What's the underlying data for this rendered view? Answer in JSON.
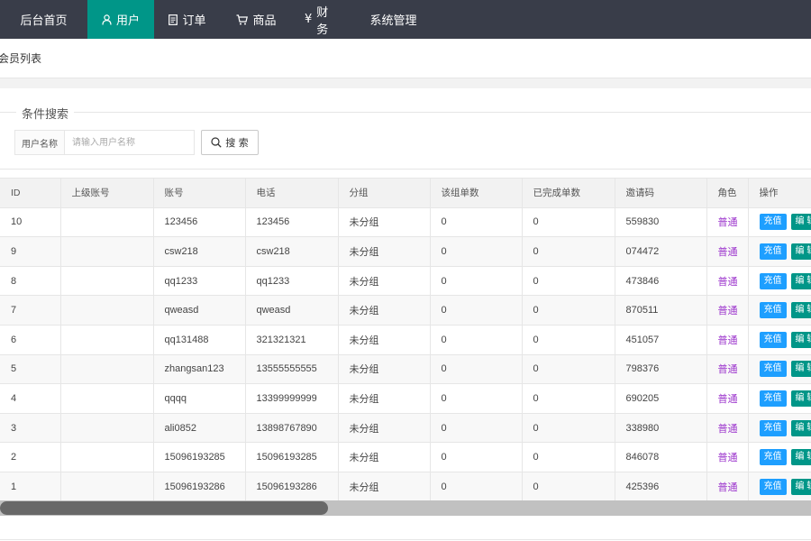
{
  "nav": {
    "items": [
      {
        "label": "后台首页",
        "icon": ""
      },
      {
        "label": "用户",
        "icon": "user-icon"
      },
      {
        "label": "订单",
        "icon": "document-icon"
      },
      {
        "label": "商品",
        "icon": "cart-icon"
      },
      {
        "label": "财务",
        "icon": "yen-icon",
        "prefix": "¥"
      },
      {
        "label": "系统管理",
        "icon": ""
      }
    ],
    "active_index": 1,
    "colors": {
      "bar": "#393d49",
      "active": "#009688"
    }
  },
  "breadcrumb": {
    "title": "会员列表"
  },
  "search": {
    "legend": "条件搜索",
    "field_label": "用户名称",
    "placeholder": "请输入用户名称",
    "value": "",
    "button_label": "搜 索"
  },
  "table": {
    "columns": [
      "ID",
      "上级账号",
      "账号",
      "电话",
      "分组",
      "该组单数",
      "已完成单数",
      "邀请码",
      "角色",
      "操作"
    ],
    "rows": [
      {
        "id": "10",
        "parent": "",
        "account": "123456",
        "phone": "123456",
        "group": "未分组",
        "group_orders": "0",
        "completed": "0",
        "invite": "559830",
        "role": "普通"
      },
      {
        "id": "9",
        "parent": "",
        "account": "csw218",
        "phone": "csw218",
        "group": "未分组",
        "group_orders": "0",
        "completed": "0",
        "invite": "074472",
        "role": "普通"
      },
      {
        "id": "8",
        "parent": "",
        "account": "qq1233",
        "phone": "qq1233",
        "group": "未分组",
        "group_orders": "0",
        "completed": "0",
        "invite": "473846",
        "role": "普通"
      },
      {
        "id": "7",
        "parent": "",
        "account": "qweasd",
        "phone": "qweasd",
        "group": "未分组",
        "group_orders": "0",
        "completed": "0",
        "invite": "870511",
        "role": "普通"
      },
      {
        "id": "6",
        "parent": "",
        "account": "qq131488",
        "phone": "321321321",
        "group": "未分组",
        "group_orders": "0",
        "completed": "0",
        "invite": "451057",
        "role": "普通"
      },
      {
        "id": "5",
        "parent": "",
        "account": "zhangsan123",
        "phone": "13555555555",
        "group": "未分组",
        "group_orders": "0",
        "completed": "0",
        "invite": "798376",
        "role": "普通"
      },
      {
        "id": "4",
        "parent": "",
        "account": "qqqq",
        "phone": "13399999999",
        "group": "未分组",
        "group_orders": "0",
        "completed": "0",
        "invite": "690205",
        "role": "普通"
      },
      {
        "id": "3",
        "parent": "",
        "account": "ali0852",
        "phone": "13898767890",
        "group": "未分组",
        "group_orders": "0",
        "completed": "0",
        "invite": "338980",
        "role": "普通"
      },
      {
        "id": "2",
        "parent": "",
        "account": "15096193285",
        "phone": "15096193285",
        "group": "未分组",
        "group_orders": "0",
        "completed": "0",
        "invite": "846078",
        "role": "普通"
      },
      {
        "id": "1",
        "parent": "",
        "account": "15096193286",
        "phone": "15096193286",
        "group": "未分组",
        "group_orders": "0",
        "completed": "0",
        "invite": "425396",
        "role": "普通"
      }
    ],
    "actions": {
      "recharge": "充值",
      "edit": "编 辑"
    },
    "colors": {
      "role": "#9b33cc",
      "recharge": "#1e9fff",
      "edit": "#009688"
    }
  }
}
